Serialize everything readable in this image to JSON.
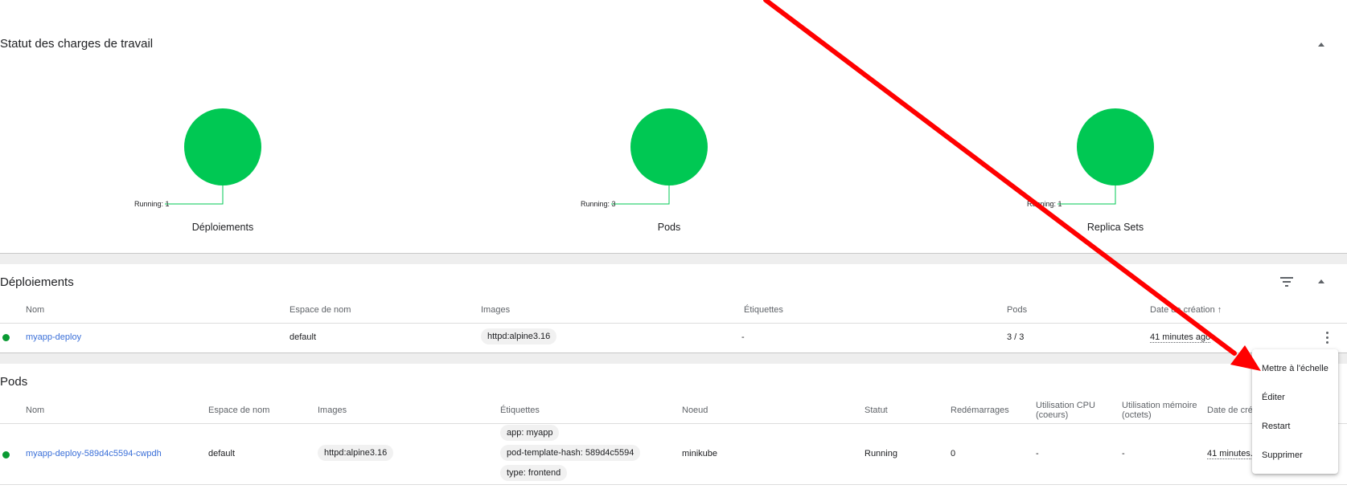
{
  "workload_status": {
    "title": "Statut des charges de travail",
    "charts": [
      {
        "label": "Déploiements",
        "callout": "Running: 1",
        "color": "#00c853"
      },
      {
        "label": "Pods",
        "callout": "Running: 3",
        "color": "#00c853"
      },
      {
        "label": "Replica Sets",
        "callout": "Running: 1",
        "color": "#00c853"
      }
    ]
  },
  "deployments": {
    "title": "Déploiements",
    "columns": [
      "Nom",
      "Espace de nom",
      "Images",
      "Étiquettes",
      "Pods",
      "Date de création"
    ],
    "rows": [
      {
        "name": "myapp-deploy",
        "namespace": "default",
        "image": "httpd:alpine3.16",
        "labels": "-",
        "pods": "3 / 3",
        "created": "41 minutes ago"
      }
    ]
  },
  "pods": {
    "title": "Pods",
    "columns": [
      "Nom",
      "Espace de nom",
      "Images",
      "Étiquettes",
      "Noeud",
      "Statut",
      "Redémarrages",
      "Utilisation CPU",
      "(coeurs)",
      "Utilisation mémoire",
      "(octets)",
      "Date de créa"
    ],
    "rows": [
      {
        "name": "myapp-deploy-589d4c5594-cwpdh",
        "namespace": "default",
        "image": "httpd:alpine3.16",
        "labels": [
          "app: myapp",
          "pod-template-hash: 589d4c5594",
          "type: frontend"
        ],
        "node": "minikube",
        "status": "Running",
        "restarts": "0",
        "cpu": "-",
        "memory": "-",
        "created": "41 minutes..."
      }
    ]
  },
  "context_menu": {
    "items": [
      "Mettre à l'échelle",
      "Éditer",
      "Restart",
      "Supprimer"
    ]
  },
  "colors": {
    "running": "#00c853",
    "status_dot": "#0a9a33",
    "link": "#3a6fd8",
    "annotation_arrow": "#ff0000"
  }
}
